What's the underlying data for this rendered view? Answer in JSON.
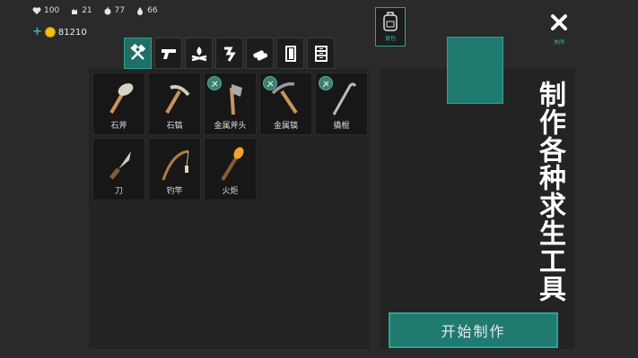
{
  "stats": {
    "health": "100",
    "hunger": "21",
    "food": "77",
    "water": "66"
  },
  "currency": {
    "coins": "81210"
  },
  "tabs": [
    {
      "icon": "hammer-axe-icon",
      "active": true
    },
    {
      "icon": "gun-icon"
    },
    {
      "icon": "campfire-icon"
    },
    {
      "icon": "meat-icon"
    },
    {
      "icon": "logs-icon"
    },
    {
      "icon": "door-icon"
    },
    {
      "icon": "cabinet-icon"
    }
  ],
  "items": [
    {
      "label": "石斧",
      "icon": "stone-axe-icon",
      "badge": false
    },
    {
      "label": "石镐",
      "icon": "stone-pickaxe-icon",
      "badge": false
    },
    {
      "label": "金属斧头",
      "icon": "metal-axe-icon",
      "badge": true
    },
    {
      "label": "金属镐",
      "icon": "metal-pickaxe-icon",
      "badge": true
    },
    {
      "label": "撬棍",
      "icon": "crowbar-icon",
      "badge": true
    },
    {
      "label": "刀",
      "icon": "knife-icon",
      "badge": false
    },
    {
      "label": "钓竿",
      "icon": "fishing-rod-icon",
      "badge": false
    },
    {
      "label": "火炬",
      "icon": "torch-icon",
      "badge": false
    }
  ],
  "backpack": {
    "label": "背包"
  },
  "close": {
    "label": "关闭"
  },
  "promo_text": "制作各种求生工具",
  "start_button": "开始制作",
  "colors": {
    "accent": "#1f7a70",
    "accent_border": "#2fa394"
  }
}
